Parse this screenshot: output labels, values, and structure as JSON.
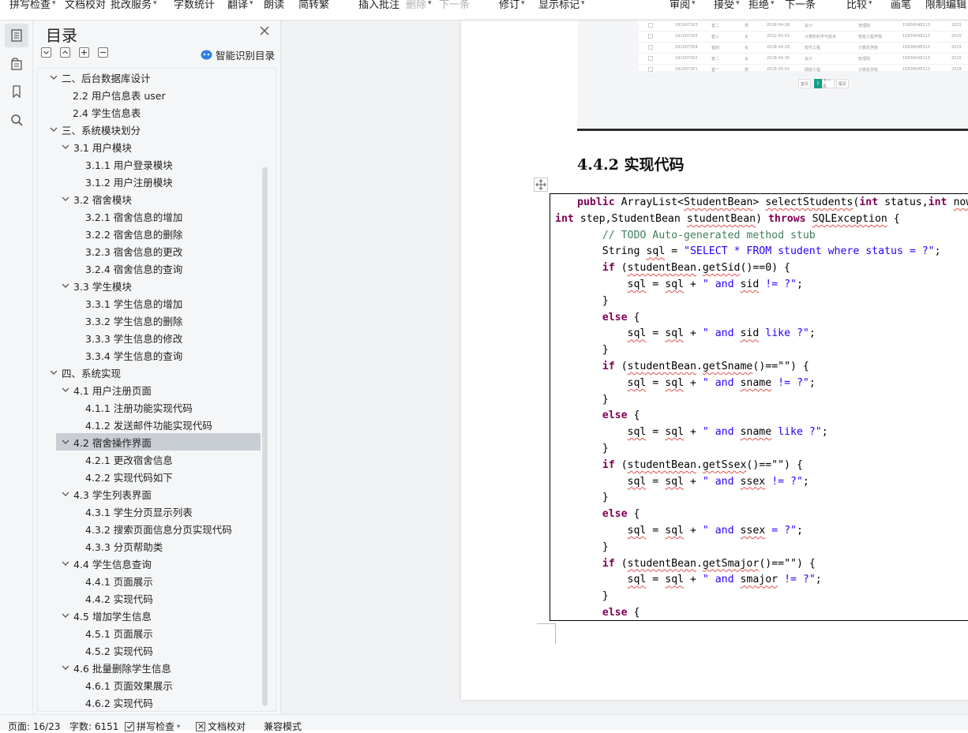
{
  "ribbon": {
    "items": [
      {
        "label": "拼写检查",
        "caret": true,
        "dim": false
      },
      {
        "label": "文档校对",
        "caret": false,
        "dim": false
      },
      {
        "label": "批改服务",
        "caret": true,
        "dim": false
      },
      {
        "label": "字数统计",
        "caret": false,
        "dim": false
      },
      {
        "label": "翻译",
        "caret": true,
        "dim": false
      },
      {
        "label": "朗读",
        "caret": false,
        "dim": false
      },
      {
        "label": "简转繁",
        "caret": false,
        "dim": false
      },
      {
        "label": "插入批注",
        "caret": false,
        "dim": false
      },
      {
        "label": "删除",
        "caret": true,
        "dim": true
      },
      {
        "label": "下一条",
        "caret": false,
        "dim": true
      },
      {
        "label": "修订",
        "caret": true,
        "dim": false
      },
      {
        "label": "显示标记",
        "caret": true,
        "dim": false
      },
      {
        "label": "审阅",
        "caret": true,
        "dim": false
      },
      {
        "label": "接受",
        "caret": true,
        "dim": false
      },
      {
        "label": "拒绝",
        "caret": true,
        "dim": false
      },
      {
        "label": "下一条",
        "caret": false,
        "dim": false
      },
      {
        "label": "比较",
        "caret": true,
        "dim": false
      },
      {
        "label": "画笔",
        "caret": false,
        "dim": false
      },
      {
        "label": "限制编辑",
        "caret": false,
        "dim": false
      }
    ]
  },
  "rail": {
    "icons": [
      "toc-icon",
      "navigation-icon",
      "bookmark-icon",
      "search-icon"
    ]
  },
  "toc": {
    "title": "目录",
    "smart_label": "智能识别目录",
    "items": [
      {
        "text": "二、后台数据库设计",
        "level": 1,
        "chevron": true,
        "selected": false
      },
      {
        "text": "2.2  用户信息表 user",
        "level": 2,
        "chevron": false,
        "selected": false
      },
      {
        "text": "2.4 学生信息表",
        "level": 2,
        "chevron": false,
        "selected": false
      },
      {
        "text": "三、系统模块划分",
        "level": 1,
        "chevron": true,
        "selected": false
      },
      {
        "text": "3.1  用户模块",
        "level": 2,
        "chevron": true,
        "selected": false
      },
      {
        "text": "3.1.1  用户登录模块",
        "level": 3,
        "chevron": false,
        "selected": false
      },
      {
        "text": "3.1.2 用户注册模块",
        "level": 3,
        "chevron": false,
        "selected": false
      },
      {
        "text": "3.2  宿舍模块",
        "level": 2,
        "chevron": true,
        "selected": false
      },
      {
        "text": "3.2.1  宿舍信息的增加",
        "level": 3,
        "chevron": false,
        "selected": false
      },
      {
        "text": "3.2.2  宿舍信息的删除",
        "level": 3,
        "chevron": false,
        "selected": false
      },
      {
        "text": "3.2.3  宿舍信息的更改",
        "level": 3,
        "chevron": false,
        "selected": false
      },
      {
        "text": "3.2.4  宿舍信息的查询",
        "level": 3,
        "chevron": false,
        "selected": false
      },
      {
        "text": "3.3 学生模块",
        "level": 2,
        "chevron": true,
        "selected": false
      },
      {
        "text": "3.3.1 学生信息的增加",
        "level": 3,
        "chevron": false,
        "selected": false
      },
      {
        "text": "3.3.2 学生信息的删除",
        "level": 3,
        "chevron": false,
        "selected": false
      },
      {
        "text": "3.3.3 学生信息的修改",
        "level": 3,
        "chevron": false,
        "selected": false
      },
      {
        "text": "3.3.4 学生信息的查询",
        "level": 3,
        "chevron": false,
        "selected": false
      },
      {
        "text": "四、系统实现",
        "level": 1,
        "chevron": true,
        "selected": false
      },
      {
        "text": "4.1 用户注册页面",
        "level": 2,
        "chevron": true,
        "selected": false
      },
      {
        "text": "4.1.1 注册功能实现代码",
        "level": 3,
        "chevron": false,
        "selected": false
      },
      {
        "text": "4.1.2 发送邮件功能实现代码",
        "level": 3,
        "chevron": false,
        "selected": false
      },
      {
        "text": "4.2 宿舍操作界面",
        "level": 2,
        "chevron": true,
        "selected": true
      },
      {
        "text": "4.2.1 更改宿舍信息",
        "level": 3,
        "chevron": false,
        "selected": false
      },
      {
        "text": "4.2.2 实现代码如下",
        "level": 3,
        "chevron": false,
        "selected": false
      },
      {
        "text": "4.3 学生列表界面",
        "level": 2,
        "chevron": true,
        "selected": false
      },
      {
        "text": "4.3.1  学生分页显示列表",
        "level": 3,
        "chevron": false,
        "selected": false
      },
      {
        "text": "4.3.2 搜索页面信息分页实现代码",
        "level": 3,
        "chevron": false,
        "selected": false
      },
      {
        "text": "4.3.3 分页帮助类",
        "level": 3,
        "chevron": false,
        "selected": false
      },
      {
        "text": "4.4 学生信息查询",
        "level": 2,
        "chevron": true,
        "selected": false
      },
      {
        "text": "4.4.1 页面展示",
        "level": 3,
        "chevron": false,
        "selected": false
      },
      {
        "text": "4.4.2 实现代码",
        "level": 3,
        "chevron": false,
        "selected": false
      },
      {
        "text": "4.5 增加学生信息",
        "level": 2,
        "chevron": true,
        "selected": false
      },
      {
        "text": "4.5.1  页面展示",
        "level": 3,
        "chevron": false,
        "selected": false
      },
      {
        "text": "4.5.2 实现代码",
        "level": 3,
        "chevron": false,
        "selected": false
      },
      {
        "text": "4.6  批量删除学生信息",
        "level": 2,
        "chevron": true,
        "selected": false
      },
      {
        "text": "4.6.1 页面效果展示",
        "level": 3,
        "chevron": false,
        "selected": false
      },
      {
        "text": "4.6.2  实现代码",
        "level": 3,
        "chevron": false,
        "selected": false
      }
    ]
  },
  "document": {
    "screenshot_rows": [
      [
        "181007303",
        "崔二",
        "男",
        "2018-04-28",
        "会计",
        "管理院",
        "15836048113",
        "2015"
      ],
      [
        "181007305",
        "崔三",
        "女",
        "2012-05-01",
        "计算机科学与技术",
        "智能工程学院",
        "15836048113",
        "2015"
      ],
      [
        "181007304",
        "崔四",
        "女",
        "2018-04-29",
        "软件工程",
        "计算机学院",
        "15836048113",
        "2015"
      ],
      [
        "181007302",
        "崔二",
        "女",
        "2018-04-30",
        "会计",
        "管理院",
        "15836048113",
        "2015"
      ],
      [
        "181007301",
        "崔一",
        "男",
        "2018-05-01",
        "网络工程",
        "计算机学院",
        "15836048113",
        "2018"
      ]
    ],
    "pager": [
      "首页",
      "1",
      "下一页",
      "尾页"
    ],
    "heading": "4.4.2 实现代码",
    "code": [
      [
        [
          "kw",
          "public "
        ],
        [
          "",
          "ArrayList<"
        ],
        [
          "sq",
          "StudentBean"
        ],
        [
          "",
          "> "
        ],
        [
          "sq",
          "selectStudents"
        ],
        [
          "",
          "("
        ],
        [
          "kw",
          "int "
        ],
        [
          "",
          "status,"
        ],
        [
          "kw",
          "int "
        ],
        [
          "sq",
          "nowP"
        ]
      ],
      [
        [
          "kw",
          "int "
        ],
        [
          "",
          "step,StudentBean "
        ],
        [
          "sq",
          "studentBean"
        ],
        [
          "",
          ") "
        ],
        [
          "kw",
          "throws "
        ],
        [
          "sq",
          "SQLException"
        ],
        [
          "",
          " {"
        ]
      ],
      [
        [
          "",
          "    "
        ],
        [
          "cm",
          "// TODO Auto-generated method stub"
        ]
      ],
      [
        [
          "",
          "    String "
        ],
        [
          "sq",
          "sql"
        ],
        [
          "",
          " = "
        ],
        [
          "str",
          "\"SELECT * FROM student where status = ?\""
        ],
        [
          "",
          ";"
        ]
      ],
      [
        [
          "",
          "    "
        ],
        [
          "kw",
          "if "
        ],
        [
          "",
          "("
        ],
        [
          "sq",
          "studentBean"
        ],
        [
          "",
          "."
        ],
        [
          "sq",
          "getSid"
        ],
        [
          "",
          "()==0) {"
        ]
      ],
      [
        [
          "",
          "        "
        ],
        [
          "sq",
          "sql"
        ],
        [
          "",
          " = "
        ],
        [
          "sq",
          "sql"
        ],
        [
          "",
          " + "
        ],
        [
          "str",
          "\" and "
        ],
        [
          "sq",
          "sid"
        ],
        [
          "str",
          " != ?\""
        ],
        [
          "",
          ";"
        ]
      ],
      [
        [
          "",
          "    }"
        ]
      ],
      [
        [
          "",
          "    "
        ],
        [
          "kw",
          "else "
        ],
        [
          "",
          "{"
        ]
      ],
      [
        [
          "",
          "        "
        ],
        [
          "sq",
          "sql"
        ],
        [
          "",
          " = "
        ],
        [
          "sq",
          "sql"
        ],
        [
          "",
          " + "
        ],
        [
          "str",
          "\" and "
        ],
        [
          "sq",
          "sid"
        ],
        [
          "str",
          " like ?\""
        ],
        [
          "",
          ";"
        ]
      ],
      [
        [
          "",
          "    }"
        ]
      ],
      [
        [
          "",
          "    "
        ],
        [
          "kw",
          "if "
        ],
        [
          "",
          "("
        ],
        [
          "sq",
          "studentBean"
        ],
        [
          "",
          "."
        ],
        [
          "sq",
          "getSname"
        ],
        [
          "",
          "()==\"\") {"
        ]
      ],
      [
        [
          "",
          "        "
        ],
        [
          "sq",
          "sql"
        ],
        [
          "",
          " = "
        ],
        [
          "sq",
          "sql"
        ],
        [
          "",
          " + "
        ],
        [
          "str",
          "\" and "
        ],
        [
          "sq",
          "sname"
        ],
        [
          "str",
          " != ?\""
        ],
        [
          "",
          ";"
        ]
      ],
      [
        [
          "",
          "    }"
        ]
      ],
      [
        [
          "",
          "    "
        ],
        [
          "kw",
          "else "
        ],
        [
          "",
          "{"
        ]
      ],
      [
        [
          "",
          "        "
        ],
        [
          "sq",
          "sql"
        ],
        [
          "",
          " = "
        ],
        [
          "sq",
          "sql"
        ],
        [
          "",
          " + "
        ],
        [
          "str",
          "\" and "
        ],
        [
          "sq",
          "sname"
        ],
        [
          "str",
          " like ?\""
        ],
        [
          "",
          ";"
        ]
      ],
      [
        [
          "",
          "    }"
        ]
      ],
      [
        [
          "",
          "    "
        ],
        [
          "kw",
          "if "
        ],
        [
          "",
          "("
        ],
        [
          "sq",
          "studentBean"
        ],
        [
          "",
          "."
        ],
        [
          "sq",
          "getSsex"
        ],
        [
          "",
          "()==\"\") {"
        ]
      ],
      [
        [
          "",
          "        "
        ],
        [
          "sq",
          "sql"
        ],
        [
          "",
          " = "
        ],
        [
          "sq",
          "sql"
        ],
        [
          "",
          " + "
        ],
        [
          "str",
          "\" and "
        ],
        [
          "sq",
          "ssex"
        ],
        [
          "str",
          " != ?\""
        ],
        [
          "",
          ";"
        ]
      ],
      [
        [
          "",
          "    }"
        ]
      ],
      [
        [
          "",
          "    "
        ],
        [
          "kw",
          "else "
        ],
        [
          "",
          "{"
        ]
      ],
      [
        [
          "",
          "        "
        ],
        [
          "sq",
          "sql"
        ],
        [
          "",
          " = "
        ],
        [
          "sq",
          "sql"
        ],
        [
          "",
          " + "
        ],
        [
          "str",
          "\" and "
        ],
        [
          "sq",
          "ssex"
        ],
        [
          "str",
          " = ?\""
        ],
        [
          "",
          ";"
        ]
      ],
      [
        [
          "",
          "    }"
        ]
      ],
      [
        [
          "",
          "    "
        ],
        [
          "kw",
          "if "
        ],
        [
          "",
          "("
        ],
        [
          "sq",
          "studentBean"
        ],
        [
          "",
          "."
        ],
        [
          "sq",
          "getSmajor"
        ],
        [
          "",
          "()==\"\") {"
        ]
      ],
      [
        [
          "",
          "        "
        ],
        [
          "sq",
          "sql"
        ],
        [
          "",
          " = "
        ],
        [
          "sq",
          "sql"
        ],
        [
          "",
          " + "
        ],
        [
          "str",
          "\" and "
        ],
        [
          "sq",
          "smajor"
        ],
        [
          "str",
          " != ?\""
        ],
        [
          "",
          ";"
        ]
      ],
      [
        [
          "",
          "    }"
        ]
      ],
      [
        [
          "",
          "    "
        ],
        [
          "kw",
          "else "
        ],
        [
          "",
          "{"
        ]
      ]
    ]
  },
  "status": {
    "page": "页面: 16/23",
    "words": "字数: 6151",
    "spell": "拼写检查",
    "proof": "文档校对",
    "mode": "兼容模式"
  }
}
